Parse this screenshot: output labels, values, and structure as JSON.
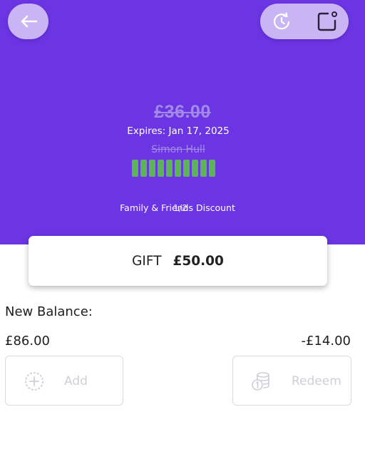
{
  "hero": {
    "price": "£36.00",
    "expires": "Expires: Jan 17, 2025",
    "owner": "Simon Hull",
    "stamps_filled": 10,
    "discount_label": "Family & Friends Discount",
    "pager": "1/2"
  },
  "header": {
    "back_icon": "arrow-left-icon",
    "history_icon": "refresh-clock-icon",
    "share_icon": "open-external-icon"
  },
  "gift": {
    "label": "GIFT",
    "amount": "£50.00"
  },
  "balance": {
    "title": "New Balance:",
    "left_value": "£86.00",
    "right_value": "-£14.00"
  },
  "actions": {
    "add_label": "Add",
    "redeem_label": "Redeem",
    "add_icon": "plus-circle-icon",
    "redeem_icon": "coins-icon"
  },
  "colors": {
    "hero_bg": "#6c35e3",
    "pill_bg": "#c9b5f3",
    "stamp": "#5cb35a"
  }
}
